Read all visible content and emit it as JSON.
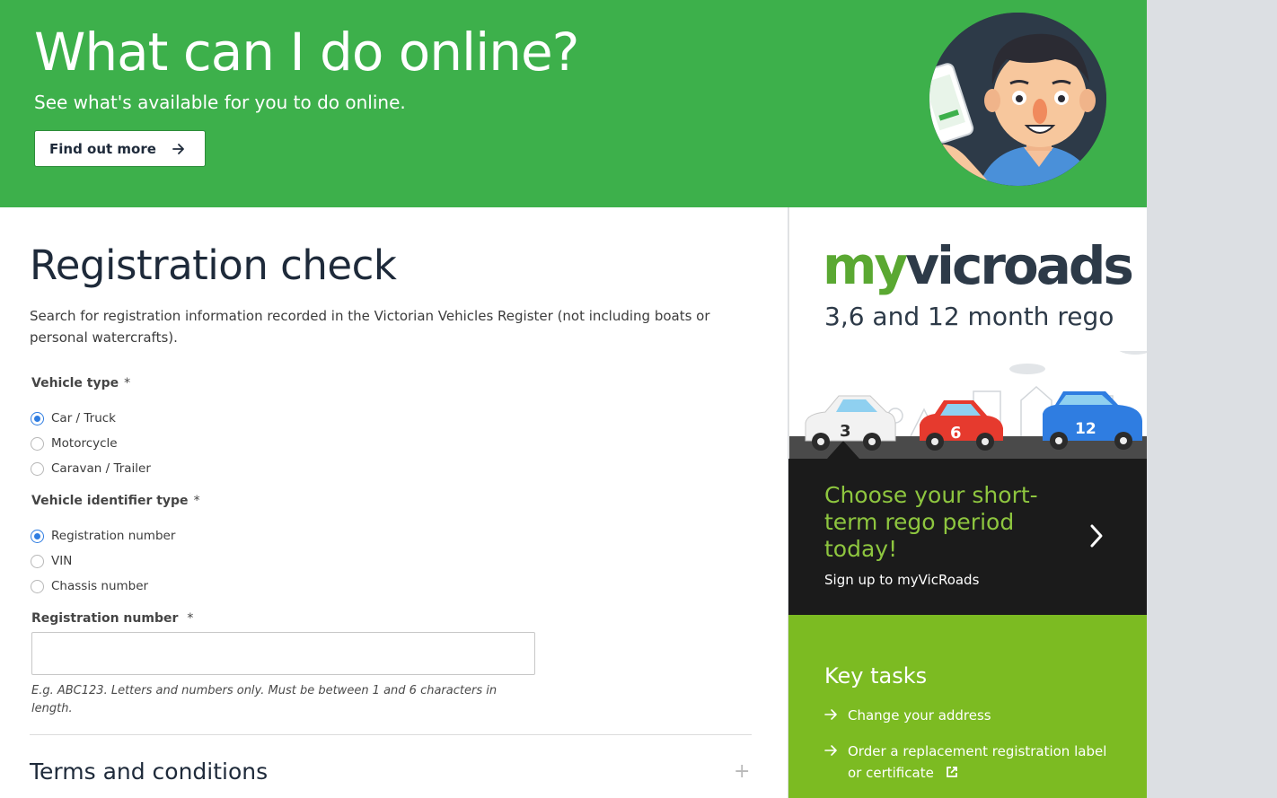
{
  "hero": {
    "title": "What can I do online?",
    "subtitle": "See what's available for you to do online.",
    "button_label": "Find out more"
  },
  "form": {
    "title": "Registration check",
    "description": "Search for registration information recorded in the Victorian Vehicles Register (not including boats or personal watercrafts).",
    "vehicle_type": {
      "label": "Vehicle type",
      "required_mark": "*",
      "options": [
        "Car / Truck",
        "Motorcycle",
        "Caravan / Trailer"
      ],
      "selected": "Car / Truck"
    },
    "identifier_type": {
      "label": "Vehicle identifier type",
      "required_mark": "*",
      "options": [
        "Registration number",
        "VIN",
        "Chassis number"
      ],
      "selected": "Registration number"
    },
    "registration_number": {
      "label": "Registration number",
      "required_mark": "*",
      "value": "",
      "hint": "E.g. ABC123. Letters and numbers only. Must be between 1 and 6 characters in length."
    },
    "terms_title": "Terms and conditions",
    "expand_symbol": "+"
  },
  "sidebar": {
    "logo_my": "my",
    "logo_vicroads": "vicroads",
    "rego_tagline": "3,6 and 12 month rego",
    "car_numbers": [
      "3",
      "6",
      "12"
    ],
    "promo_heading": "Choose your short-term rego period today!",
    "promo_link": "Sign up to myVicRoads",
    "key_tasks": {
      "title": "Key tasks",
      "items": [
        "Change your address",
        "Order a replacement registration label or certificate"
      ]
    }
  },
  "colors": {
    "hero_green": "#3db04b",
    "promo_black": "#1b1b1b",
    "promo_text_green": "#8ec63f",
    "tasks_green": "#7cbb22",
    "radio_blue": "#2f7de1",
    "heading_navy": "#1e2a3a"
  }
}
